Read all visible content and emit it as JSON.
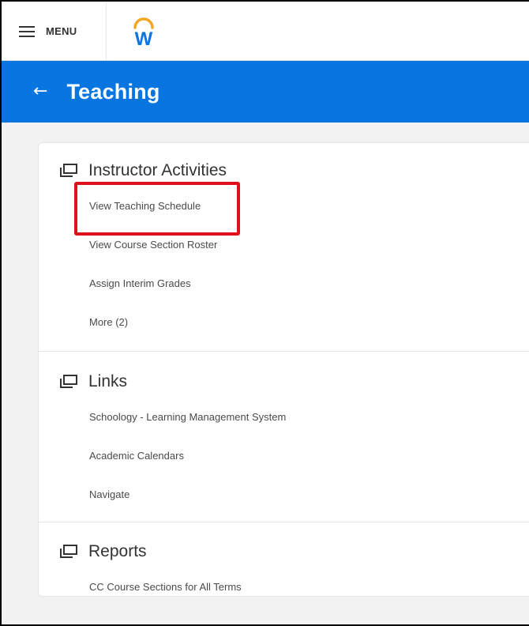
{
  "topbar": {
    "menu_label": "MENU",
    "logo_icon": "workday-logo",
    "logo_letter": "W",
    "logo_color": "#0875e1",
    "logo_arc_color": "#f5a623"
  },
  "header": {
    "back_icon": "arrow-left-icon",
    "title": "Teaching",
    "bg_color": "#0875e1"
  },
  "sections": [
    {
      "title": "Instructor Activities",
      "icon": "windows-icon",
      "links": [
        "View Teaching Schedule",
        "View Course Section Roster",
        "Assign Interim Grades",
        "More (2)"
      ]
    },
    {
      "title": "Links",
      "icon": "windows-icon",
      "links": [
        "Schoology - Learning Management System",
        "Academic Calendars",
        "Navigate"
      ]
    },
    {
      "title": "Reports",
      "icon": "windows-icon",
      "links": [
        "CC Course Sections for All Terms"
      ]
    }
  ],
  "annotation": {
    "highlighted_item": "View Teaching Schedule",
    "color": "#e0101a"
  }
}
